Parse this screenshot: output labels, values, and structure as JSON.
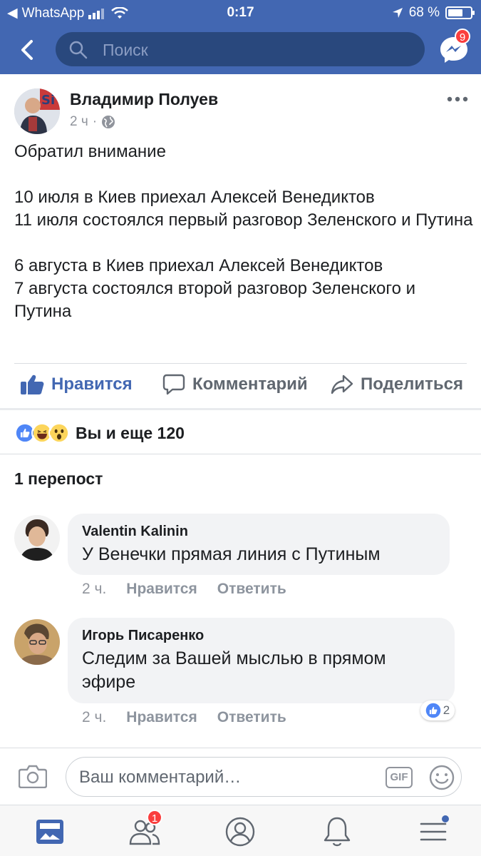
{
  "status_bar": {
    "back_app": "WhatsApp",
    "time": "0:17",
    "battery": "68 %",
    "battery_level": 0.68
  },
  "search": {
    "placeholder": "Поиск"
  },
  "messenger": {
    "badge": "9"
  },
  "post": {
    "author": "Владимир Полуев",
    "time": "2 ч",
    "separator": "·",
    "text": "Обратил внимание\n\n10 июля в Киев приехал Алексей Венедиктов\n11 июля состоялся первый разговор Зеленского и Путина\n\n6 августа в Киев приехал Алексей Венедиктов\n7 августа состоялся второй разговор Зеленского и Путина"
  },
  "actions": {
    "like": "Нравится",
    "comment": "Комментарий",
    "share": "Поделиться"
  },
  "reactions": {
    "summary": "Вы и еще 120",
    "types": [
      "like",
      "haha",
      "wow"
    ]
  },
  "reposts": "1 перепост",
  "comments": [
    {
      "name": "Valentin Kalinin",
      "text": "У Венечки прямая линия с Путиным",
      "time": "2 ч.",
      "like": "Нравится",
      "reply": "Ответить"
    },
    {
      "name": "Игорь Писаренко",
      "text": "Следим за Вашей мыслью в прямом эфире",
      "time": "2 ч.",
      "like": "Нравится",
      "reply": "Ответить",
      "reactions_count": "2"
    }
  ],
  "composer": {
    "placeholder": "Ваш комментарий…",
    "gif": "GIF"
  },
  "tabbar": {
    "friends_badge": "1"
  },
  "colors": {
    "brand": "#4267b2",
    "badge": "#fa3e3e",
    "bubble": "#f2f3f5"
  }
}
